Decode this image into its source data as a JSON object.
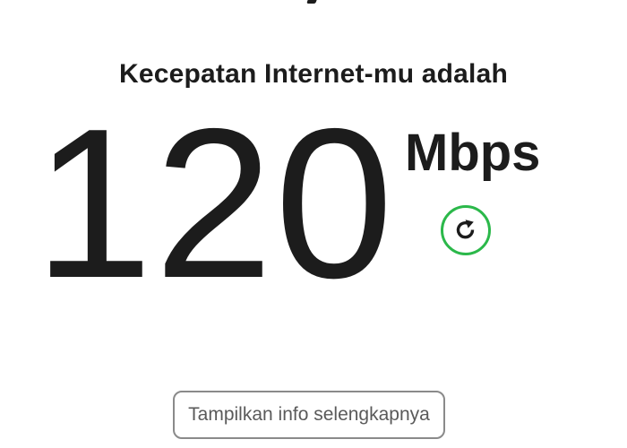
{
  "heading": "Kecepatan Internet-mu adalah",
  "speed": {
    "value": "120",
    "unit": "Mbps"
  },
  "buttons": {
    "refresh_icon": "refresh-icon",
    "more_info_label": "Tampilkan info selengkapnya"
  },
  "colors": {
    "text": "#1c1c1c",
    "accent_green": "#2bb84a",
    "button_border": "#8a8a8a",
    "button_text": "#5a5a5a",
    "background": "#ffffff"
  }
}
